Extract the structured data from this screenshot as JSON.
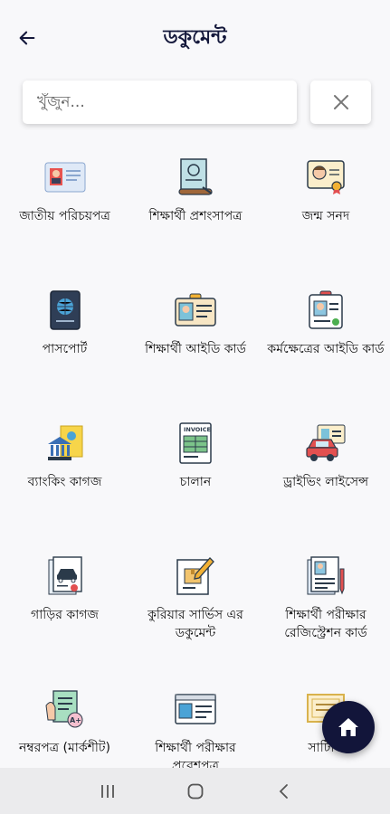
{
  "header": {
    "title": "ডকুমেন্ট",
    "back_icon": "arrow-left-icon"
  },
  "search": {
    "placeholder": "খুঁজুন...",
    "value": ""
  },
  "clear_icon": "close-icon",
  "documents": [
    {
      "label": "জাতীয় পরিচয়পত্র",
      "icon": "id-card-icon"
    },
    {
      "label": "শিক্ষার্থী প্রশংসাপত্র",
      "icon": "testimonial-scroll-icon"
    },
    {
      "label": "জন্ম সনদ",
      "icon": "birth-certificate-icon"
    },
    {
      "label": "পাসপোর্ট",
      "icon": "passport-icon"
    },
    {
      "label": "শিক্ষার্থী আইডি কার্ড",
      "icon": "student-id-card-icon"
    },
    {
      "label": "কর্মক্ষেত্রের আইডি কার্ড",
      "icon": "work-id-badge-icon"
    },
    {
      "label": "ব্যাংকিং কাগজ",
      "icon": "bank-document-icon"
    },
    {
      "label": "চালান",
      "icon": "invoice-icon"
    },
    {
      "label": "ড্রাইভিং লাইসেন্স",
      "icon": "driving-license-icon"
    },
    {
      "label": "গাড়ির কাগজ",
      "icon": "car-document-icon"
    },
    {
      "label": "কুরিয়ার সার্ভিস এর ডকুমেন্ট",
      "icon": "courier-document-icon"
    },
    {
      "label": "শিক্ষার্থী পরীক্ষার রেজিস্ট্রেশন কার্ড",
      "icon": "exam-registration-icon"
    },
    {
      "label": "নম্বরপত্র (মার্কশীট)",
      "icon": "marksheet-icon"
    },
    {
      "label": "শিক্ষার্থী পরীক্ষার প্রবেশপত্র",
      "icon": "admit-card-icon"
    },
    {
      "label": "সার্টিফি",
      "icon": "certificate-icon"
    }
  ],
  "fab": {
    "icon": "home-icon"
  },
  "navbar": {
    "recent_icon": "recent-apps-icon",
    "home_icon": "nav-home-icon",
    "back_icon": "nav-back-icon"
  }
}
